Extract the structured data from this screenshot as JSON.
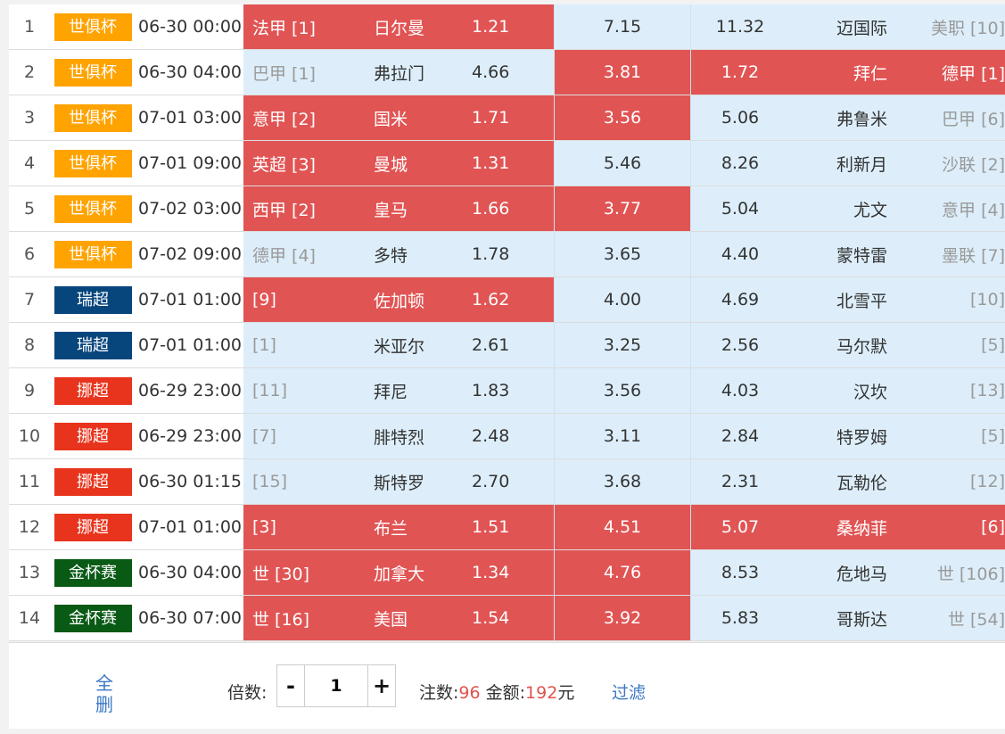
{
  "colors": {
    "selected": "#e15454",
    "unselected": "#ddeefa",
    "club_wc": "#ffa300",
    "swiss": "#07467d",
    "norway": "#e8341c",
    "gold_cup": "#095a15"
  },
  "rows": [
    {
      "idx": "1",
      "league": "世俱杯",
      "league_color": "#ffa300",
      "time": "06-30 00:00",
      "home_rank": "法甲 [1]",
      "home": "日尔曼",
      "o1": "1.21",
      "o2": "7.15",
      "o3": "11.32",
      "away": "迈国际",
      "away_rank": "美职 [10]",
      "sel": [
        1,
        0,
        0
      ],
      "home_rank_muted": false,
      "away_rank_muted": true
    },
    {
      "idx": "2",
      "league": "世俱杯",
      "league_color": "#ffa300",
      "time": "06-30 04:00",
      "home_rank": "巴甲 [1]",
      "home": "弗拉门",
      "o1": "4.66",
      "o2": "3.81",
      "o3": "1.72",
      "away": "拜仁",
      "away_rank": "德甲 [1]",
      "sel": [
        0,
        1,
        1
      ],
      "home_rank_muted": true,
      "away_rank_muted": false
    },
    {
      "idx": "3",
      "league": "世俱杯",
      "league_color": "#ffa300",
      "time": "07-01 03:00",
      "home_rank": "意甲 [2]",
      "home": "国米",
      "o1": "1.71",
      "o2": "3.56",
      "o3": "5.06",
      "away": "弗鲁米",
      "away_rank": "巴甲 [6]",
      "sel": [
        1,
        1,
        0
      ],
      "home_rank_muted": false,
      "away_rank_muted": true
    },
    {
      "idx": "4",
      "league": "世俱杯",
      "league_color": "#ffa300",
      "time": "07-01 09:00",
      "home_rank": "英超 [3]",
      "home": "曼城",
      "o1": "1.31",
      "o2": "5.46",
      "o3": "8.26",
      "away": "利新月",
      "away_rank": "沙联 [2]",
      "sel": [
        1,
        0,
        0
      ],
      "home_rank_muted": false,
      "away_rank_muted": true
    },
    {
      "idx": "5",
      "league": "世俱杯",
      "league_color": "#ffa300",
      "time": "07-02 03:00",
      "home_rank": "西甲 [2]",
      "home": "皇马",
      "o1": "1.66",
      "o2": "3.77",
      "o3": "5.04",
      "away": "尤文",
      "away_rank": "意甲 [4]",
      "sel": [
        1,
        1,
        0
      ],
      "home_rank_muted": false,
      "away_rank_muted": true
    },
    {
      "idx": "6",
      "league": "世俱杯",
      "league_color": "#ffa300",
      "time": "07-02 09:00",
      "home_rank": "德甲 [4]",
      "home": "多特",
      "o1": "1.78",
      "o2": "3.65",
      "o3": "4.40",
      "away": "蒙特雷",
      "away_rank": "墨联 [7]",
      "sel": [
        0,
        0,
        0
      ],
      "home_rank_muted": true,
      "away_rank_muted": true
    },
    {
      "idx": "7",
      "league": "瑞超",
      "league_color": "#07467d",
      "time": "07-01 01:00",
      "home_rank": "[9]",
      "home": "佐加顿",
      "o1": "1.62",
      "o2": "4.00",
      "o3": "4.69",
      "away": "北雪平",
      "away_rank": "[10]",
      "sel": [
        1,
        0,
        0
      ],
      "home_rank_muted": false,
      "away_rank_muted": true
    },
    {
      "idx": "8",
      "league": "瑞超",
      "league_color": "#07467d",
      "time": "07-01 01:00",
      "home_rank": "[1]",
      "home": "米亚尔",
      "o1": "2.61",
      "o2": "3.25",
      "o3": "2.56",
      "away": "马尔默",
      "away_rank": "[5]",
      "sel": [
        0,
        0,
        0
      ],
      "home_rank_muted": true,
      "away_rank_muted": true
    },
    {
      "idx": "9",
      "league": "挪超",
      "league_color": "#e8341c",
      "time": "06-29 23:00",
      "home_rank": "[11]",
      "home": "拜尼",
      "o1": "1.83",
      "o2": "3.56",
      "o3": "4.03",
      "away": "汉坎",
      "away_rank": "[13]",
      "sel": [
        0,
        0,
        0
      ],
      "home_rank_muted": true,
      "away_rank_muted": true
    },
    {
      "idx": "10",
      "league": "挪超",
      "league_color": "#e8341c",
      "time": "06-29 23:00",
      "home_rank": "[7]",
      "home": "腓特烈",
      "o1": "2.48",
      "o2": "3.11",
      "o3": "2.84",
      "away": "特罗姆",
      "away_rank": "[5]",
      "sel": [
        0,
        0,
        0
      ],
      "home_rank_muted": true,
      "away_rank_muted": true
    },
    {
      "idx": "11",
      "league": "挪超",
      "league_color": "#e8341c",
      "time": "06-30 01:15",
      "home_rank": "[15]",
      "home": "斯特罗",
      "o1": "2.70",
      "o2": "3.68",
      "o3": "2.31",
      "away": "瓦勒伦",
      "away_rank": "[12]",
      "sel": [
        0,
        0,
        0
      ],
      "home_rank_muted": true,
      "away_rank_muted": true
    },
    {
      "idx": "12",
      "league": "挪超",
      "league_color": "#e8341c",
      "time": "07-01 01:00",
      "home_rank": "[3]",
      "home": "布兰",
      "o1": "1.51",
      "o2": "4.51",
      "o3": "5.07",
      "away": "桑纳菲",
      "away_rank": "[6]",
      "sel": [
        1,
        1,
        1
      ],
      "home_rank_muted": false,
      "away_rank_muted": false
    },
    {
      "idx": "13",
      "league": "金杯赛",
      "league_color": "#095a15",
      "time": "06-30 04:00",
      "home_rank": "世 [30]",
      "home": "加拿大",
      "o1": "1.34",
      "o2": "4.76",
      "o3": "8.53",
      "away": "危地马",
      "away_rank": "世 [106]",
      "sel": [
        1,
        1,
        0
      ],
      "home_rank_muted": false,
      "away_rank_muted": true
    },
    {
      "idx": "14",
      "league": "金杯赛",
      "league_color": "#095a15",
      "time": "06-30 07:00",
      "home_rank": "世 [16]",
      "home": "美国",
      "o1": "1.54",
      "o2": "3.92",
      "o3": "5.83",
      "away": "哥斯达",
      "away_rank": "世 [54]",
      "sel": [
        1,
        1,
        0
      ],
      "home_rank_muted": false,
      "away_rank_muted": true
    }
  ],
  "footer": {
    "delete_all": "全删",
    "multiplier_label": "倍数:",
    "minus": "-",
    "multiplier_value": "1",
    "plus": "+",
    "bets_label": "注数:",
    "bets_value": "96",
    "amount_label": "金额:",
    "amount_value": "192",
    "amount_unit": "元",
    "filter": "过滤"
  }
}
